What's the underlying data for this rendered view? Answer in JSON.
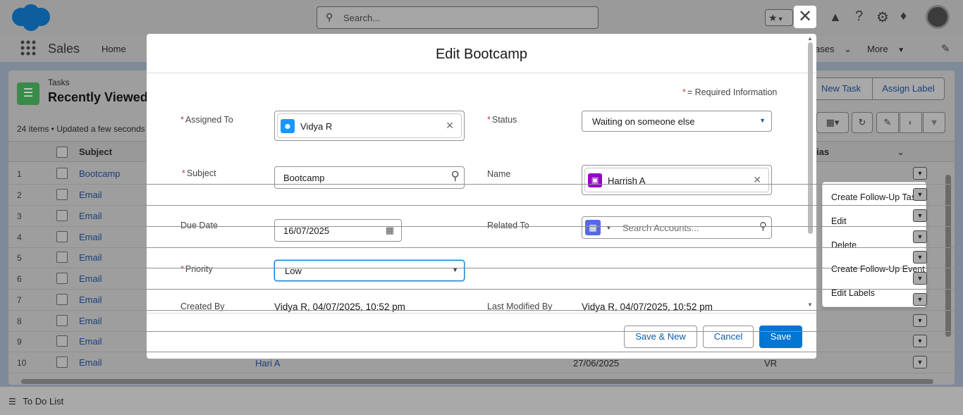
{
  "header": {
    "search_placeholder": "Search...",
    "app_name": "Sales",
    "nav_home": "Home",
    "nav_cases": "ases",
    "nav_more": "More"
  },
  "list": {
    "object_label": "Tasks",
    "view_name": "Recently Viewed",
    "status": "24 items • Updated a few seconds",
    "new_task": "New Task",
    "assign_label": "Assign Label",
    "col_subject": "Subject",
    "col_alias": "ias",
    "rows": [
      {
        "num": "1",
        "subject": "Bootcamp"
      },
      {
        "num": "2",
        "subject": "Email"
      },
      {
        "num": "3",
        "subject": "Email"
      },
      {
        "num": "4",
        "subject": "Email"
      },
      {
        "num": "5",
        "subject": "Email"
      },
      {
        "num": "6",
        "subject": "Email"
      },
      {
        "num": "7",
        "subject": "Email"
      },
      {
        "num": "8",
        "subject": "Email"
      },
      {
        "num": "9",
        "subject": "Email"
      },
      {
        "num": "10",
        "subject": "Email"
      }
    ],
    "row10_name": "Hari A",
    "row10_date": "27/06/2025",
    "row10_alias": "VR"
  },
  "footer_util": {
    "todo": "To Do List"
  },
  "modal": {
    "title": "Edit Bootcamp",
    "required_info": "= Required Information",
    "assigned_to_label": "Assigned To",
    "assigned_to_value": "Vidya R",
    "status_label": "Status",
    "status_value": "Waiting on someone else",
    "subject_label": "Subject",
    "subject_value": "Bootcamp",
    "name_label": "Name",
    "name_value": "Harrish A",
    "due_date_label": "Due Date",
    "due_date_value": "16/07/2025",
    "related_to_label": "Related To",
    "related_to_placeholder": "Search Accounts...",
    "priority_label": "Priority",
    "priority_value": "Low",
    "created_by_label": "Created By",
    "created_by_value": "Vidya R, 04/07/2025, 10:52 pm",
    "last_modified_label": "Last Modified By",
    "last_modified_value": "Vidya R, 04/07/2025, 10:52 pm",
    "save_new": "Save & New",
    "cancel": "Cancel",
    "save": "Save"
  },
  "row_menu": {
    "items": [
      "Create Follow-Up Task",
      "Edit",
      "Delete",
      "Create Follow-Up Event",
      "Edit Labels"
    ]
  },
  "colors": {
    "brand": "#0176d3",
    "required": "#c23934"
  }
}
